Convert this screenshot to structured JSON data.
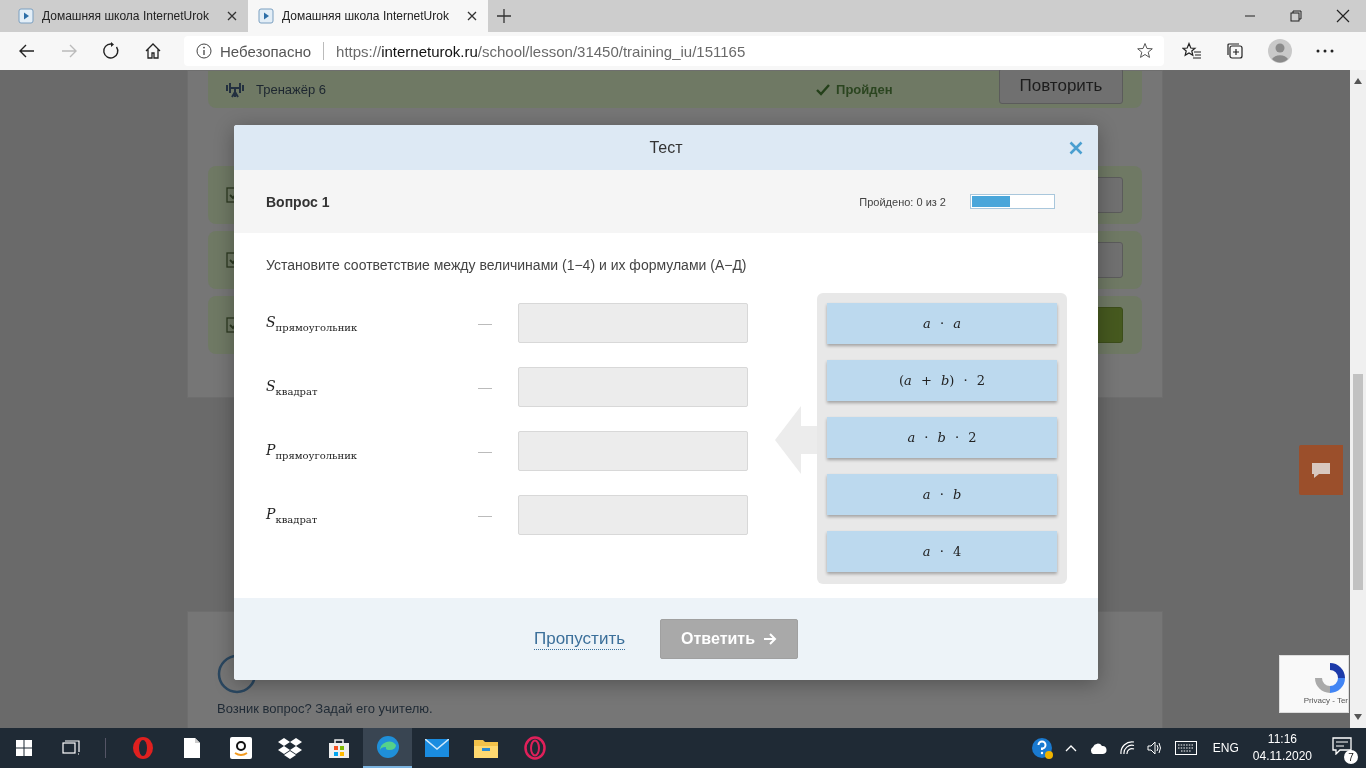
{
  "browser": {
    "tabs": [
      {
        "title": "Домашняя школа InternetUrok",
        "selected": false
      },
      {
        "title": "Домашняя школа InternetUrok",
        "selected": true
      }
    ],
    "security_label": "Небезопасно",
    "url": {
      "scheme": "https://",
      "host": "interneturok.ru",
      "path": "/school/lesson/31450/training_iu/151165"
    }
  },
  "page": {
    "trainer_row": {
      "title": "Тренажёр 6",
      "status": "Пройден",
      "button": "Повторить"
    },
    "task_rows": [
      {
        "checked": true,
        "kind": "secondary"
      },
      {
        "checked": true,
        "kind": "secondary"
      },
      {
        "checked": true,
        "kind": "primary"
      }
    ],
    "help_text": "Возник вопрос? Задай его учителю."
  },
  "modal": {
    "title": "Тест",
    "question": "Вопрос 1",
    "progress_label": "Пройдено: 0 из 2",
    "progress": {
      "level": 0.47
    },
    "instruction": "Установите соответствие между величинами (1−4) и их формулами (А−Д)",
    "pairs": [
      {
        "label": "*S*$_{прямоугольник}$",
        "dash": "—"
      },
      {
        "label": "*S*$_{квадрат}$",
        "dash": "—"
      },
      {
        "label": "*P*$_{прямоугольник}$",
        "dash": "—"
      },
      {
        "label": "*P*$_{квадрат}$",
        "dash": "—"
      }
    ],
    "options": [
      "*a* · *a*",
      "(*a* + *b*) · 2",
      "*a* · *b* · 2",
      "*a* · *b*",
      "*a* · 4"
    ],
    "skip": "Пропустить",
    "submit": {
      "label": "Ответить",
      "disabled": true
    }
  },
  "recaptcha": {
    "text": "Privacy - Ter"
  },
  "taskbar": {
    "apps": [
      {
        "kind": "opera",
        "active": false
      },
      {
        "kind": "file",
        "active": false
      },
      {
        "kind": "amazon",
        "active": false
      },
      {
        "kind": "dropbox",
        "active": false
      },
      {
        "kind": "store",
        "active": false
      },
      {
        "kind": "edge",
        "active": true
      },
      {
        "kind": "mail",
        "active": false
      },
      {
        "kind": "folder",
        "active": false
      },
      {
        "kind": "opera-gx",
        "active": false
      }
    ],
    "language": "ENG",
    "time": "11:16",
    "date": "04.11.2020",
    "notifications": "7"
  }
}
